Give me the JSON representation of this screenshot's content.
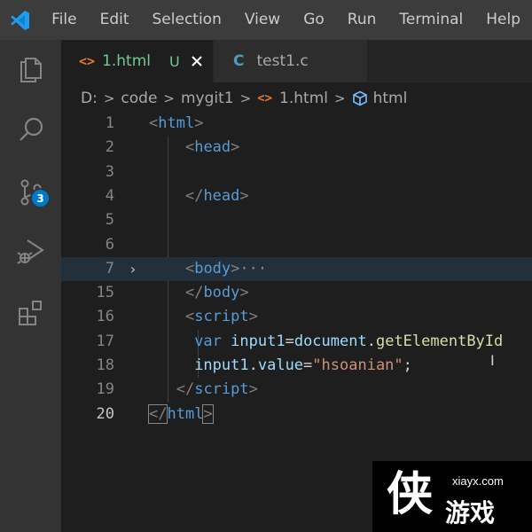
{
  "menu": {
    "app_icon": "vscode-logo-icon",
    "items": [
      "File",
      "Edit",
      "Selection",
      "View",
      "Go",
      "Run",
      "Terminal",
      "Help"
    ]
  },
  "activity_bar": {
    "items": [
      "explorer-icon",
      "search-icon",
      "source-control-icon",
      "run-debug-icon",
      "extensions-icon"
    ],
    "source_control_badge": "3"
  },
  "tabs": [
    {
      "icon": "html-file-icon",
      "label": "1.html",
      "status": "U",
      "close": "close-icon",
      "active": true
    },
    {
      "icon": "c-file-icon",
      "icon_text": "C",
      "label": "test1.c",
      "active": false
    }
  ],
  "breadcrumb": {
    "parts": [
      "D:",
      "code",
      "mygit1",
      "1.html",
      "html"
    ],
    "separator": ">"
  },
  "editor": {
    "line_numbers": [
      "1",
      "2",
      "3",
      "4",
      "5",
      "6",
      "7",
      "15",
      "16",
      "17",
      "18",
      "19",
      "20"
    ],
    "current_line": "20",
    "folded_indicator": "···",
    "lines": [
      {
        "tokens": [
          [
            "<",
            "punct"
          ],
          [
            "html",
            "tag"
          ],
          [
            ">",
            "punct"
          ]
        ]
      },
      {
        "tokens": [
          [
            "    ",
            "plain"
          ],
          [
            "<",
            "punct"
          ],
          [
            "head",
            "tag"
          ],
          [
            ">",
            "punct"
          ]
        ]
      },
      {
        "tokens": []
      },
      {
        "tokens": [
          [
            "    ",
            "plain"
          ],
          [
            "</",
            "punct"
          ],
          [
            "head",
            "tag"
          ],
          [
            ">",
            "punct"
          ]
        ]
      },
      {
        "tokens": []
      },
      {
        "tokens": []
      },
      {
        "tokens": [
          [
            "    ",
            "plain"
          ],
          [
            "<",
            "punct"
          ],
          [
            "body",
            "tag"
          ],
          [
            ">",
            "punct"
          ]
        ]
      },
      {
        "tokens": [
          [
            "    ",
            "plain"
          ],
          [
            "</",
            "punct"
          ],
          [
            "body",
            "tag"
          ],
          [
            ">",
            "punct"
          ]
        ]
      },
      {
        "tokens": [
          [
            "    ",
            "plain"
          ],
          [
            "<",
            "punct"
          ],
          [
            "script",
            "tag"
          ],
          [
            ">",
            "punct"
          ]
        ]
      },
      {
        "tokens": [
          [
            "     ",
            "plain"
          ],
          [
            "var",
            "kw"
          ],
          [
            " ",
            "plain"
          ],
          [
            "input1",
            "var"
          ],
          [
            "=",
            "plain"
          ],
          [
            "document",
            "var"
          ],
          [
            ".",
            "plain"
          ],
          [
            "getElementById",
            "fn"
          ]
        ]
      },
      {
        "tokens": [
          [
            "     ",
            "plain"
          ],
          [
            "input1",
            "var"
          ],
          [
            ".",
            "plain"
          ],
          [
            "value",
            "var"
          ],
          [
            "=",
            "plain"
          ],
          [
            "\"hsoanian\"",
            "str"
          ],
          [
            ";",
            "plain"
          ]
        ]
      },
      {
        "tokens": [
          [
            "   ",
            "plain"
          ],
          [
            "</",
            "punct"
          ],
          [
            "script",
            "tag"
          ],
          [
            ">",
            "punct"
          ]
        ]
      },
      {
        "tokens": [
          [
            "</",
            "punct"
          ],
          [
            "html",
            "tag"
          ],
          [
            ">",
            "punct"
          ]
        ]
      }
    ]
  },
  "watermark": {
    "url": "xiayx.com",
    "glyph": "侠",
    "text": "游戏"
  },
  "colors": {
    "tab_active_label": "#73c991",
    "tab_inactive_label": "#a9a9a9",
    "html_icon": "#e37933",
    "c_icon": "#519aba",
    "badge": "#007acc"
  }
}
